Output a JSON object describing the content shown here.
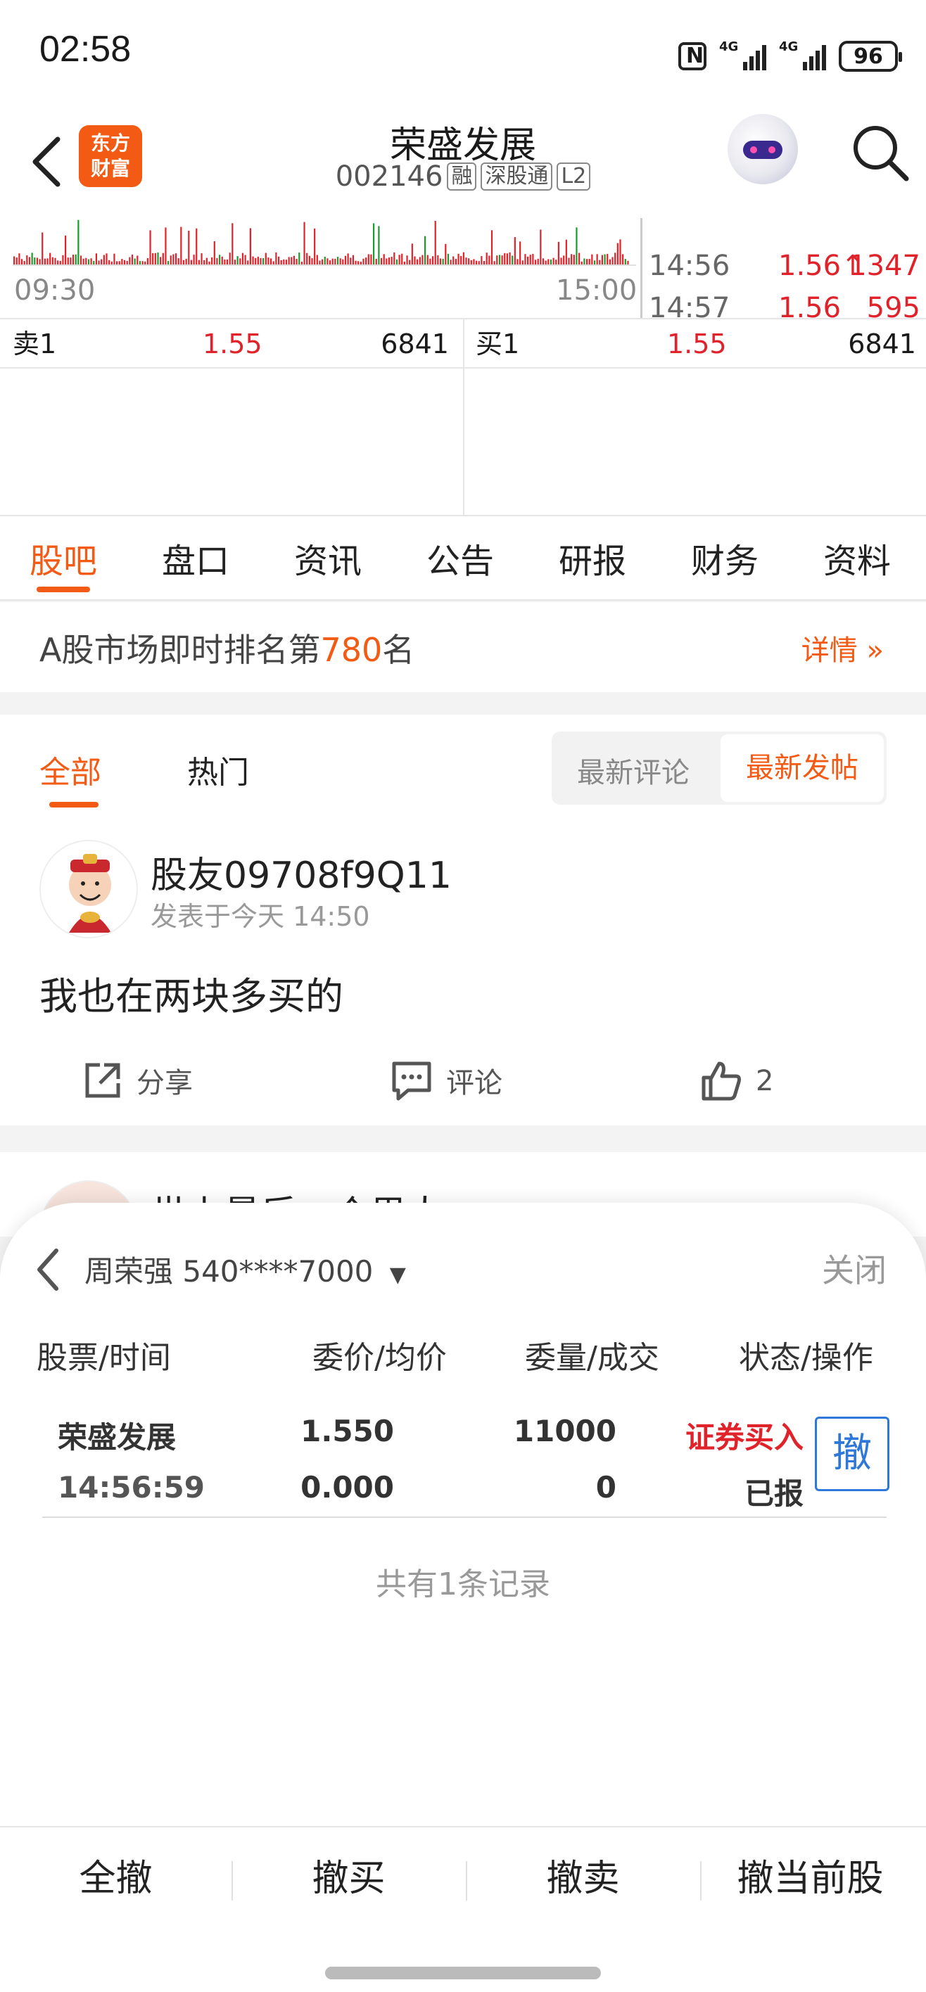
{
  "status_bar": {
    "time": "02:58",
    "battery": "96",
    "signal_label": "4G"
  },
  "header": {
    "logo_line1": "东方",
    "logo_line2": "财富",
    "stock_name": "荣盛发展",
    "stock_code": "002146",
    "tags": [
      "融",
      "深股通",
      "L2"
    ]
  },
  "chart": {
    "time_start": "09:30",
    "time_end": "15:00",
    "ticks": [
      {
        "time": "14:56",
        "price": "1.56",
        "arrow": "↑",
        "volume": "1347"
      },
      {
        "time": "14:57",
        "price": "1.56",
        "arrow": "",
        "volume": "595"
      }
    ]
  },
  "order_book": {
    "sell_label": "卖1",
    "sell_price": "1.55",
    "sell_volume": "6841",
    "buy_label": "买1",
    "buy_price": "1.55",
    "buy_volume": "6841"
  },
  "tabs": [
    "股吧",
    "盘口",
    "资讯",
    "公告",
    "研报",
    "财务",
    "资料"
  ],
  "active_tab": "股吧",
  "rank": {
    "prefix": "A股市场即时排名第",
    "number": "780",
    "suffix": "名",
    "detail": "详情"
  },
  "feed": {
    "filter_all": "全部",
    "filter_hot": "热门",
    "sort_latest_comment": "最新评论",
    "sort_latest_post": "最新发帖",
    "post": {
      "user": "股友09708f9Q11",
      "time": "发表于今天 14:50",
      "body": "我也在两块多买的",
      "share": "分享",
      "comment": "评论",
      "likes": "2"
    },
    "next_post_user": "世上最后一个男人"
  },
  "sheet": {
    "account": "周荣强 540****7000",
    "close": "关闭",
    "columns": [
      "股票/时间",
      "委价/均价",
      "委量/成交",
      "状态/操作"
    ],
    "order": {
      "stock": "荣盛发展",
      "time": "14:56:59",
      "order_price": "1.550",
      "avg_price": "0.000",
      "order_qty": "11000",
      "filled_qty": "0",
      "type": "证券买入",
      "status": "已报",
      "cancel": "撤"
    },
    "record_count": "共有1条记录",
    "actions": [
      "全撤",
      "撤买",
      "撤卖",
      "撤当前股"
    ]
  },
  "colors": {
    "accent": "#f35a14",
    "up": "#e0232b",
    "down": "#1a9a2f",
    "link_blue": "#2d78d9"
  }
}
